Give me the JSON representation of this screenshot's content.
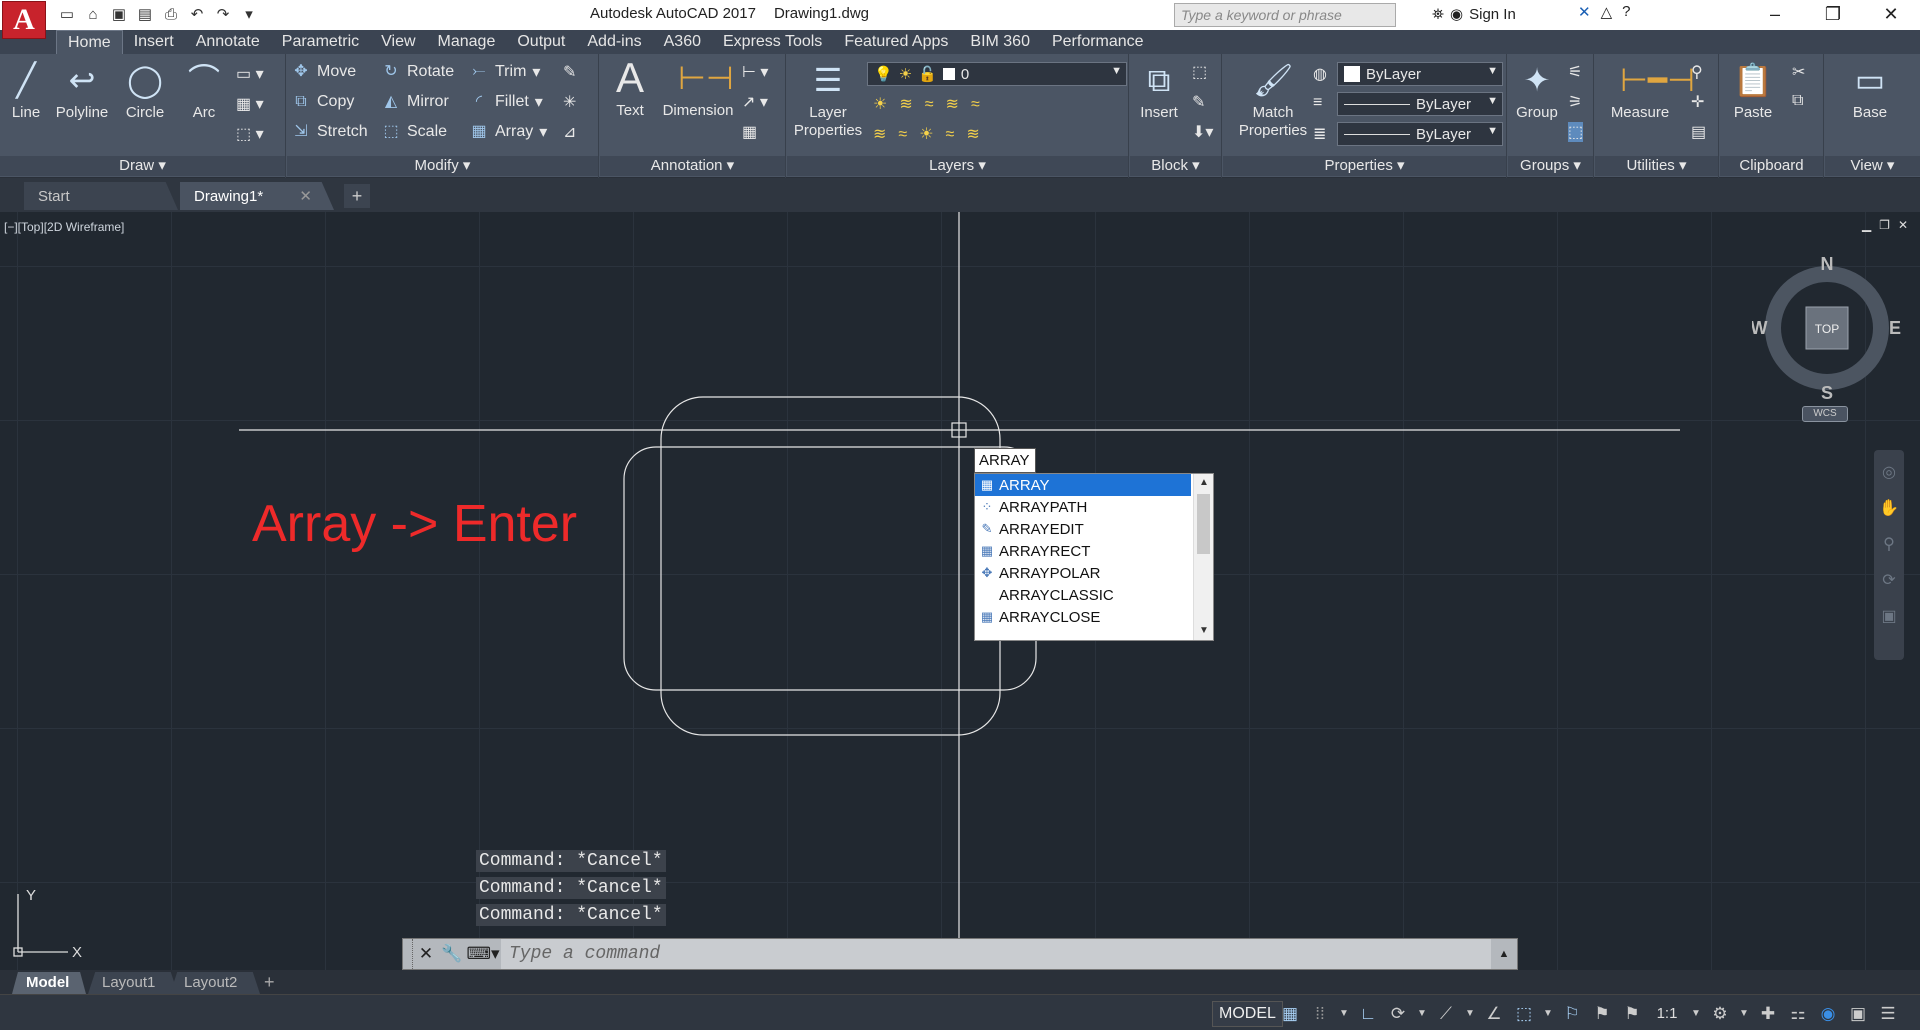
{
  "titlebar": {
    "app_letter": "A",
    "app_name": "Autodesk AutoCAD 2017",
    "document": "Drawing1.dwg",
    "search_placeholder": "Type a keyword or phrase",
    "sign_in": "Sign In"
  },
  "ribbon_tabs": [
    "Home",
    "Insert",
    "Annotate",
    "Parametric",
    "View",
    "Manage",
    "Output",
    "Add-ins",
    "A360",
    "Express Tools",
    "Featured Apps",
    "BIM 360",
    "Performance"
  ],
  "ribbon": {
    "draw": {
      "label": "Draw",
      "line": "Line",
      "polyline": "Polyline",
      "circle": "Circle",
      "arc": "Arc"
    },
    "modify": {
      "label": "Modify",
      "move": "Move",
      "rotate": "Rotate",
      "trim": "Trim",
      "copy": "Copy",
      "mirror": "Mirror",
      "fillet": "Fillet",
      "stretch": "Stretch",
      "scale": "Scale",
      "array": "Array"
    },
    "annotation": {
      "label": "Annotation",
      "text": "Text",
      "dimension": "Dimension"
    },
    "layers": {
      "label": "Layers",
      "layer_properties_1": "Layer",
      "layer_properties_2": "Properties",
      "current_layer": "0"
    },
    "block": {
      "label": "Block",
      "insert": "Insert"
    },
    "properties": {
      "label": "Properties",
      "match_1": "Match",
      "match_2": "Properties",
      "color": "ByLayer",
      "linetype": "ByLayer",
      "lineweight": "ByLayer"
    },
    "groups": {
      "label": "Groups",
      "group": "Group"
    },
    "utilities": {
      "label": "Utilities",
      "measure": "Measure"
    },
    "clipboard": {
      "label": "Clipboard",
      "paste": "Paste"
    },
    "view": {
      "label": "View",
      "base": "Base"
    }
  },
  "doc_tabs": {
    "start": "Start",
    "drawing": "Drawing1*"
  },
  "viewport": {
    "label": "[−][Top][2D Wireframe]",
    "annotation": "Array -> Enter",
    "cmd_input": "ARRAY",
    "autocomplete": [
      "ARRAY",
      "ARRAYPATH",
      "ARRAYEDIT",
      "ARRAYRECT",
      "ARRAYPOLAR",
      "ARRAYCLASSIC",
      "ARRAYCLOSE"
    ],
    "viewcube": {
      "n": "N",
      "s": "S",
      "e": "E",
      "w": "W",
      "top": "TOP",
      "wcs": "WCS"
    },
    "ucs": {
      "x": "X",
      "y": "Y"
    }
  },
  "command": {
    "history": [
      "Command: *Cancel*",
      "Command: *Cancel*",
      "Command: *Cancel*"
    ],
    "placeholder": "Type a command"
  },
  "layout_tabs": {
    "model": "Model",
    "layout1": "Layout1",
    "layout2": "Layout2"
  },
  "status": {
    "model": "MODEL",
    "scale": "1:1"
  },
  "colors": {
    "accent": "#1e73d6",
    "annotation": "#ee2a2a",
    "canvas": "#212830"
  }
}
